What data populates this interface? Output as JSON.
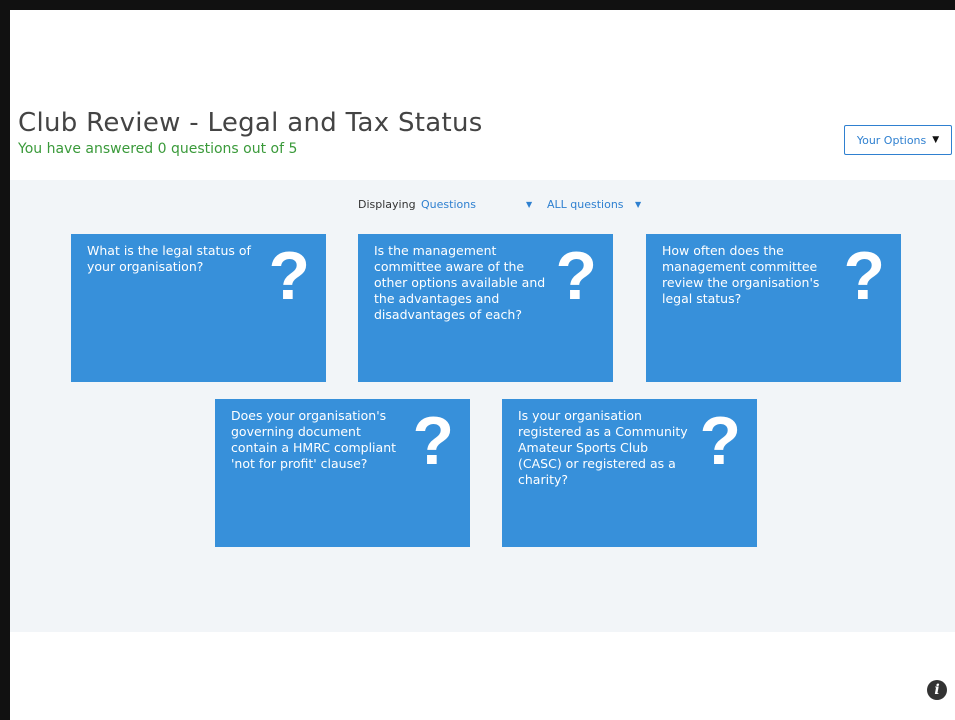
{
  "header": {
    "title": "Club Review - Legal and Tax Status",
    "progress_text": "You have answered 0 questions out of 5"
  },
  "options_button": {
    "label": "Your Options",
    "icon": "caret-down-icon"
  },
  "filter_bar": {
    "label": "Displaying",
    "display_select": "Questions",
    "scope_select": "ALL questions"
  },
  "cards": [
    {
      "question": "What is the legal status of your organisation?",
      "icon": "question-mark-icon"
    },
    {
      "question": "Is the management committee aware of the other options available and the advantages and disadvantages of each?",
      "icon": "question-mark-icon"
    },
    {
      "question": "How often does the management committee review the organisation's legal status?",
      "icon": "question-mark-icon"
    },
    {
      "question": "Does your organisation's governing document contain a HMRC compliant 'not for profit' clause?",
      "icon": "question-mark-icon"
    },
    {
      "question": "Is your organisation registered as a Community Amateur Sports Club (CASC) or registered as a charity?",
      "icon": "question-mark-icon"
    }
  ],
  "footer": {
    "info_icon": "info-icon"
  },
  "colors": {
    "card_blue": "#3790da",
    "accent_blue": "#2f80d0",
    "progress_green": "#3a9a3a",
    "panel_bg": "#f2f5f8"
  }
}
